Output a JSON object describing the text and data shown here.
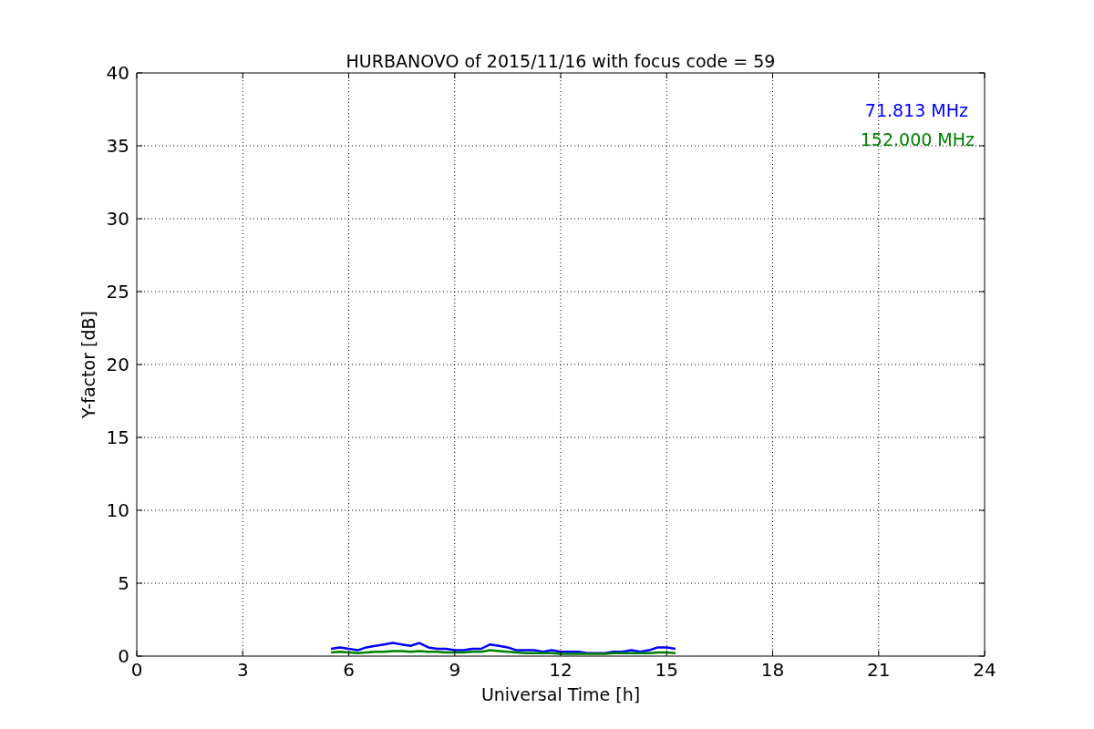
{
  "chart_data": {
    "type": "line",
    "title": "HURBANOVO of 2015/11/16 with focus code = 59",
    "xlabel": "Universal Time [h]",
    "ylabel": "Y-factor [dB]",
    "x": [
      5.5,
      5.75,
      6,
      6.25,
      6.5,
      6.75,
      7,
      7.25,
      7.5,
      7.75,
      8,
      8.25,
      8.5,
      8.75,
      9,
      9.25,
      9.5,
      9.75,
      10,
      10.25,
      10.5,
      10.75,
      11,
      11.25,
      11.5,
      11.75,
      12,
      12.25,
      12.5,
      12.75,
      13,
      13.25,
      13.5,
      13.75,
      14,
      14.25,
      14.5,
      14.75,
      15,
      15.25
    ],
    "series": [
      {
        "name": "71.813 MHz",
        "color": "#0000ff",
        "values": [
          0.5,
          0.6,
          0.5,
          0.4,
          0.6,
          0.7,
          0.8,
          0.9,
          0.8,
          0.7,
          0.9,
          0.6,
          0.5,
          0.5,
          0.4,
          0.4,
          0.5,
          0.5,
          0.8,
          0.7,
          0.6,
          0.4,
          0.4,
          0.4,
          0.3,
          0.4,
          0.3,
          0.3,
          0.3,
          0.2,
          0.2,
          0.2,
          0.3,
          0.3,
          0.4,
          0.3,
          0.4,
          0.6,
          0.6,
          0.5
        ]
      },
      {
        "name": "152.000 MHz",
        "color": "#008000",
        "values": [
          0.25,
          0.3,
          0.25,
          0.2,
          0.25,
          0.3,
          0.3,
          0.35,
          0.35,
          0.3,
          0.35,
          0.3,
          0.3,
          0.25,
          0.25,
          0.25,
          0.3,
          0.3,
          0.4,
          0.35,
          0.3,
          0.25,
          0.2,
          0.2,
          0.2,
          0.2,
          0.15,
          0.15,
          0.15,
          0.15,
          0.15,
          0.15,
          0.2,
          0.2,
          0.2,
          0.2,
          0.2,
          0.25,
          0.25,
          0.2
        ]
      }
    ],
    "grid": true,
    "xlim": [
      0,
      24
    ],
    "ylim": [
      0,
      40
    ],
    "xticks": [
      0,
      3,
      6,
      9,
      12,
      15,
      18,
      21,
      24
    ],
    "yticks": [
      0,
      5,
      10,
      15,
      20,
      25,
      30,
      35,
      40
    ]
  }
}
